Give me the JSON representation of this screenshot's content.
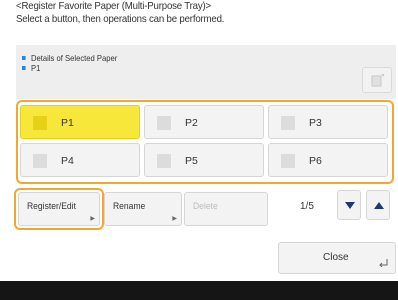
{
  "header": {
    "line1": "<Register Favorite Paper (Multi-Purpose Tray)>",
    "line2": "Select a button, then operations can be performed."
  },
  "details": {
    "label": "Details of Selected Paper",
    "value": "P1"
  },
  "paper_buttons": [
    {
      "label": "P1",
      "selected": true
    },
    {
      "label": "P2",
      "selected": false
    },
    {
      "label": "P3",
      "selected": false
    },
    {
      "label": "P4",
      "selected": false
    },
    {
      "label": "P5",
      "selected": false
    },
    {
      "label": "P6",
      "selected": false
    }
  ],
  "actions": {
    "register_edit": "Register/Edit",
    "rename": "Rename",
    "delete": "Delete"
  },
  "pagination": {
    "text": "1/5"
  },
  "close": {
    "label": "Close"
  },
  "colors": {
    "selected": "#f6e73a",
    "highlight": "#f0a830",
    "bar": "#151515"
  }
}
